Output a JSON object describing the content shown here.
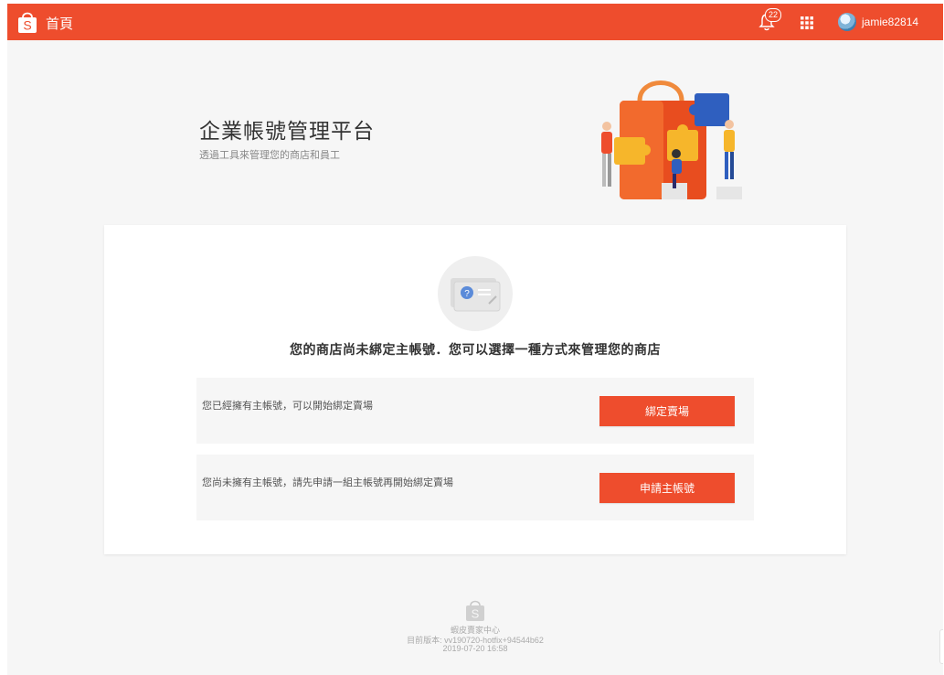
{
  "header": {
    "home_label": "首頁",
    "notification_count": "22",
    "username": "jamie82814",
    "brand_color": "#ee4d2d",
    "logo_letter": "S",
    "icons": [
      "shopee-bag-icon",
      "bell-icon",
      "apps-grid-icon",
      "avatar"
    ]
  },
  "hero": {
    "title": "企業帳號管理平台",
    "subtitle": "透過工具來管理您的商店和員工",
    "illustration": "puzzle-team-illustration"
  },
  "card": {
    "heading": "您的商店尚未綁定主帳號．您可以選擇一種方式來管理您的商店",
    "empty_icon": "id-card-question-icon",
    "options": [
      {
        "text": "您已經擁有主帳號，可以開始綁定賣場",
        "button": "綁定賣場"
      },
      {
        "text": "您尚未擁有主帳號，請先申請一組主帳號再開始綁定賣場",
        "button": "申請主帳號"
      }
    ]
  },
  "footer": {
    "center_name": "蝦皮賣家中心",
    "version": "目前版本: vv190720-hotfix+94544b62",
    "date": "2019-07-20 16:58",
    "logo_letter": "S"
  }
}
